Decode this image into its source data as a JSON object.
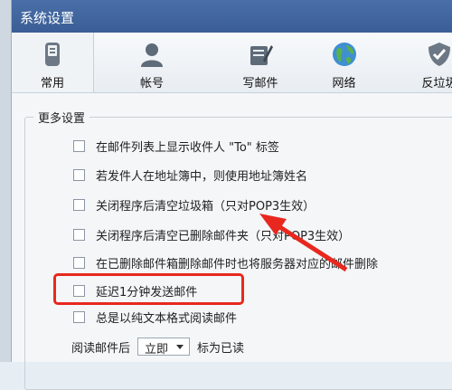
{
  "window": {
    "title": "系统设置"
  },
  "toolbar": {
    "items": [
      {
        "label": "常用",
        "icon": "phone-icon"
      },
      {
        "label": "帐号",
        "icon": "user-icon"
      },
      {
        "label": "写邮件",
        "icon": "compose-icon"
      },
      {
        "label": "网络",
        "icon": "globe-icon"
      },
      {
        "label": "反垃圾",
        "icon": "shield-icon"
      }
    ]
  },
  "more_settings": {
    "title": "更多设置",
    "options": [
      {
        "label": "在邮件列表上显示收件人 \"To\" 标签",
        "checked": false
      },
      {
        "label": "若发件人在地址簿中，则使用地址簿姓名",
        "checked": false
      },
      {
        "label": "关闭程序后清空垃圾箱（只对POP3生效）",
        "checked": false
      },
      {
        "label": "关闭程序后清空已删除邮件夹（只对POP3生效）",
        "checked": false
      },
      {
        "label": "在已删除邮件箱删除邮件时也将服务器对应的邮件删除",
        "checked": false
      },
      {
        "label": "延迟1分钟发送邮件",
        "checked": false
      },
      {
        "label": "总是以纯文本格式阅读邮件",
        "checked": false
      }
    ],
    "read_after_prefix": "阅读邮件后",
    "read_after_value": "立即",
    "read_after_suffix": "标为已读"
  },
  "annotation": {
    "highlight_color": "#e8281e"
  }
}
